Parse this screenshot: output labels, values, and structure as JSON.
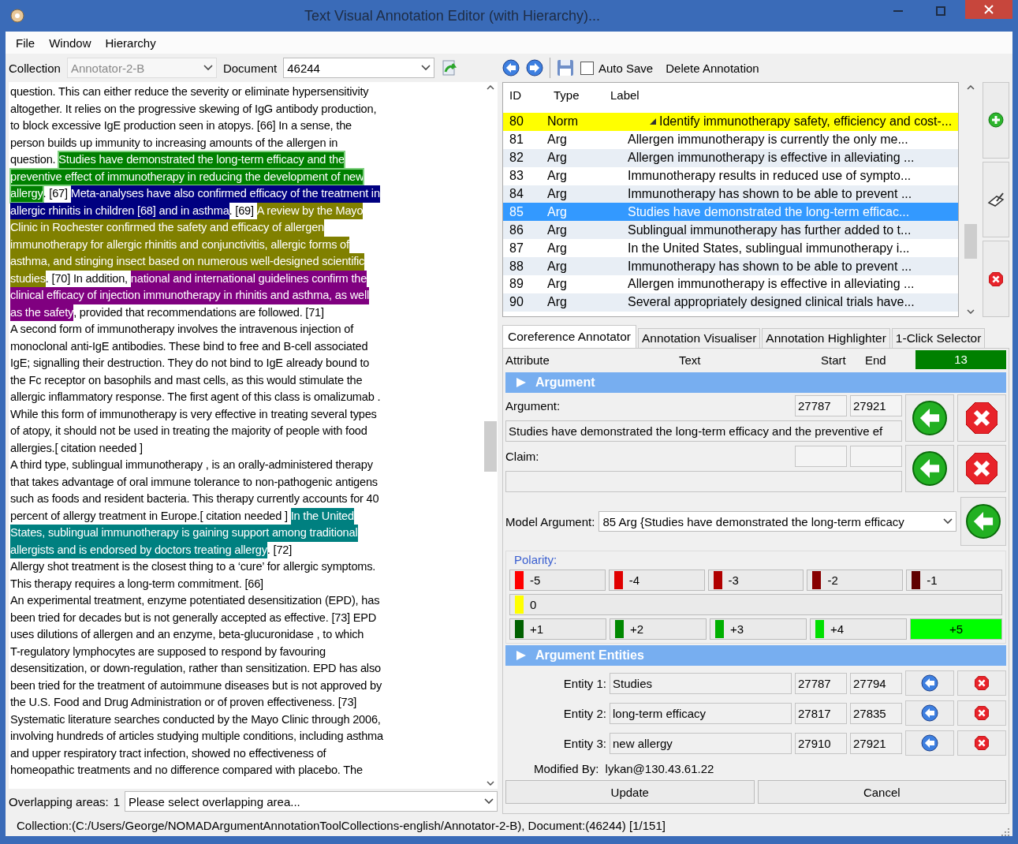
{
  "window": {
    "title": "Text Visual Annotation Editor (with Hierarchy)..."
  },
  "menu": [
    "File",
    "Window",
    "Hierarchy"
  ],
  "toolbar": {
    "collection_label": "Collection",
    "collection": "Annotator-2-B",
    "document_label": "Document",
    "document": "46244",
    "auto_save": {
      "label": "Auto Save",
      "checked": false
    },
    "delete_label": "Delete Annotation"
  },
  "document_text": [
    [
      {
        "text": "question. This can either reduce the severity or eliminate hypersensitivity"
      }
    ],
    [
      {
        "text": "altogether. It relies on the progressive skewing of IgG antibody production,"
      }
    ],
    [
      {
        "text": "to block excessive IgE production seen in atopys. [66] In a sense, the"
      }
    ],
    [
      {
        "text": "person builds up immunity to increasing amounts of the allergen in"
      }
    ],
    [
      {
        "text": "question. "
      },
      {
        "text": "Studies have demonstrated the long-term efficacy and the",
        "color": "#008000",
        "selected": true
      }
    ],
    [
      {
        "text": "preventive effect of immunotherapy in reducing the development of new",
        "color": "#008000",
        "selected": true
      }
    ],
    [
      {
        "text": "allergy",
        "color": "#008000",
        "selected": true
      },
      {
        "text": ". [67] "
      },
      {
        "text": "Meta-analyses have also confirmed efficacy of the treatment in",
        "color": "#000080",
        "selected": false
      }
    ],
    [
      {
        "text": "allergic rhinitis in children [68] and in asthma",
        "color": "#000080",
        "selected": false
      },
      {
        "text": ". [69] "
      },
      {
        "text": "A review by the Mayo",
        "color": "#808000",
        "selected": false
      }
    ],
    [
      {
        "text": "Clinic in Rochester confirmed the safety and efficacy of allergen",
        "color": "#808000",
        "selected": false
      }
    ],
    [
      {
        "text": "immunotherapy for allergic rhinitis and conjunctivitis, allergic forms of",
        "color": "#808000",
        "selected": false
      }
    ],
    [
      {
        "text": "asthma, and stinging insect based on numerous well-designed scientific",
        "color": "#808000",
        "selected": false
      }
    ],
    [
      {
        "text": "studies",
        "color": "#808000",
        "selected": false
      },
      {
        "text": ". [70] In addition, "
      },
      {
        "text": "national and international guidelines confirm the",
        "color": "#800080",
        "selected": false
      }
    ],
    [
      {
        "text": "clinical efficacy of injection immunotherapy in rhinitis and asthma, as well",
        "color": "#800080",
        "selected": false
      }
    ],
    [
      {
        "text": "as the safety",
        "color": "#800080",
        "selected": false
      },
      {
        "text": ", provided that recommendations are followed. [71]"
      }
    ],
    [
      {
        "text": "A second form of immunotherapy involves the intravenous injection of"
      }
    ],
    [
      {
        "text": "monoclonal anti-IgE antibodies. These bind to free and B-cell associated"
      }
    ],
    [
      {
        "text": "IgE; signalling their destruction. They do not bind to IgE already bound to"
      }
    ],
    [
      {
        "text": "the Fc receptor on basophils and mast cells, as this would stimulate the"
      }
    ],
    [
      {
        "text": "allergic inflammatory response. The first agent of this class is omalizumab ."
      }
    ],
    [
      {
        "text": "While this form of immunotherapy is very effective in treating several types"
      }
    ],
    [
      {
        "text": "of atopy, it should not be used in treating the majority of people with food"
      }
    ],
    [
      {
        "text": "allergies.[ citation needed ]"
      }
    ],
    [
      {
        "text": "A third type, sublingual immunotherapy , is an orally-administered therapy"
      }
    ],
    [
      {
        "text": "that takes advantage of oral immune tolerance to non-pathogenic antigens"
      }
    ],
    [
      {
        "text": "such as foods and resident bacteria. This therapy currently accounts for 40"
      }
    ],
    [
      {
        "text": "percent of allergy treatment in Europe.[ citation needed ] "
      },
      {
        "text": "In the United",
        "color": "#008080",
        "selected": false
      }
    ],
    [
      {
        "text": "States, sublingual immunotherapy is gaining support among traditional",
        "color": "#008080",
        "selected": false
      }
    ],
    [
      {
        "text": "allergists and is endorsed by doctors treating allergy",
        "color": "#008080",
        "selected": false
      },
      {
        "text": ". [72]"
      }
    ],
    [
      {
        "text": "Allergy shot treatment is the closest thing to a ‘cure’ for allergic symptoms."
      }
    ],
    [
      {
        "text": "This therapy requires a long-term commitment. [66]"
      }
    ],
    [
      {
        "text": "An experimental treatment, enzyme potentiated desensitization (EPD), has"
      }
    ],
    [
      {
        "text": "been tried for decades but is not generally accepted as effective. [73] EPD"
      }
    ],
    [
      {
        "text": "uses dilutions of allergen and an enzyme, beta-glucuronidase , to which"
      }
    ],
    [
      {
        "text": "T-regulatory lymphocytes are supposed to respond by favouring"
      }
    ],
    [
      {
        "text": "desensitization, or down-regulation, rather than sensitization. EPD has also"
      }
    ],
    [
      {
        "text": "been tried for the treatment of autoimmune diseases but is not approved by"
      }
    ],
    [
      {
        "text": "the U.S. Food and Drug Administration or of proven effectiveness. [73]"
      }
    ],
    [
      {
        "text": "Systematic literature searches conducted by the Mayo Clinic through 2006,"
      }
    ],
    [
      {
        "text": "involving hundreds of articles studying multiple conditions, including asthma"
      }
    ],
    [
      {
        "text": "and upper respiratory tract infection, showed no effectiveness of"
      }
    ],
    [
      {
        "text": "homeopathic treatments and no difference compared with placebo. The"
      }
    ]
  ],
  "overlap": {
    "label": "Overlapping areas:",
    "count": "1",
    "value": "Please select overlapping area..."
  },
  "annotations": {
    "columns": [
      "ID",
      "Type",
      "Label"
    ],
    "rows": [
      {
        "id": "80",
        "type": "Norm",
        "label": "Identify immunotherapy safety, efficiency and cost-...",
        "selected": false,
        "highlighted": true,
        "expanded": true,
        "children": [
          {
            "id": "81",
            "type": "Arg",
            "label": "Allergen immunotherapy is currently the only me...",
            "selected": false
          },
          {
            "id": "82",
            "type": "Arg",
            "label": "Allergen immunotherapy is effective in alleviating ...",
            "selected": false
          },
          {
            "id": "83",
            "type": "Arg",
            "label": "Immunotherapy results in reduced use of sympto...",
            "selected": false
          },
          {
            "id": "84",
            "type": "Arg",
            "label": "Immunotherapy has shown to be able to prevent ...",
            "selected": false
          },
          {
            "id": "85",
            "type": "Arg",
            "label": "Studies have demonstrated the long-term efficac...",
            "selected": true
          },
          {
            "id": "86",
            "type": "Arg",
            "label": "Sublingual immunotherapy has further added to t...",
            "selected": false
          },
          {
            "id": "87",
            "type": "Arg",
            "label": "In the United States, sublingual immunotherapy i...",
            "selected": false
          },
          {
            "id": "88",
            "type": "Arg",
            "label": "Immunotherapy has shown to be able to prevent ...",
            "selected": false
          },
          {
            "id": "89",
            "type": "Arg",
            "label": "Allergen immunotherapy is effective in alleviating ...",
            "selected": false
          },
          {
            "id": "90",
            "type": "Arg",
            "label": "Several appropriately designed clinical trials have...",
            "selected": false
          }
        ]
      }
    ]
  },
  "tabs": [
    {
      "label": "Coreference Annotator",
      "selected": true
    },
    {
      "label": "Annotation Visualiser",
      "selected": false
    },
    {
      "label": "Annotation Highlighter",
      "selected": false
    },
    {
      "label": "1-Click Selector",
      "selected": false
    }
  ],
  "editor": {
    "header": {
      "attribute": "Attribute",
      "text": "Text",
      "start": "Start",
      "end": "End",
      "count": "13"
    },
    "argument_section": "Argument",
    "argument": {
      "label": "Argument:",
      "start": "27787",
      "end": "27921",
      "text": "Studies have demonstrated the long-term efficacy and the preventive ef"
    },
    "claim": {
      "label": "Claim:"
    },
    "model_argument": {
      "label": "Model Argument:",
      "value": "85 Arg {Studies have demonstrated the long-term efficacy"
    },
    "polarity": {
      "label": "Polarity:",
      "rows": [
        [
          {
            "label": "-5",
            "color": "#ff0000",
            "selected": false
          },
          {
            "label": "-4",
            "color": "#e00000",
            "selected": false
          },
          {
            "label": "-3",
            "color": "#b00000",
            "selected": false
          },
          {
            "label": "-2",
            "color": "#880000",
            "selected": false
          },
          {
            "label": "-1",
            "color": "#600000",
            "selected": false
          }
        ],
        [
          {
            "label": "0",
            "color": "#ffff00",
            "selected": false
          }
        ],
        [
          {
            "label": "+1",
            "color": "#006000",
            "selected": false
          },
          {
            "label": "+2",
            "color": "#008800",
            "selected": false
          },
          {
            "label": "+3",
            "color": "#00b000",
            "selected": false
          },
          {
            "label": "+4",
            "color": "#00e000",
            "selected": false
          },
          {
            "label": "+5",
            "color": "#00ff00",
            "selected": true
          }
        ]
      ]
    },
    "entities_section": "Argument Entities",
    "entities": [
      {
        "label": "Entity 1:",
        "text": "Studies",
        "start": "27787",
        "end": "27794"
      },
      {
        "label": "Entity 2:",
        "text": "long-term efficacy",
        "start": "27817",
        "end": "27835"
      },
      {
        "label": "Entity 3:",
        "text": "new allergy",
        "start": "27910",
        "end": "27921"
      }
    ],
    "modified_by": {
      "label": "Modified By:",
      "value": "lykan@130.43.61.22"
    },
    "buttons": [
      "Update",
      "Cancel"
    ]
  },
  "status_bar": "Collection:(C:/Users/George/NOMADArgumentAnnotationToolCollections-english/Annotator-2-B), Document:(46244) [1/151]"
}
